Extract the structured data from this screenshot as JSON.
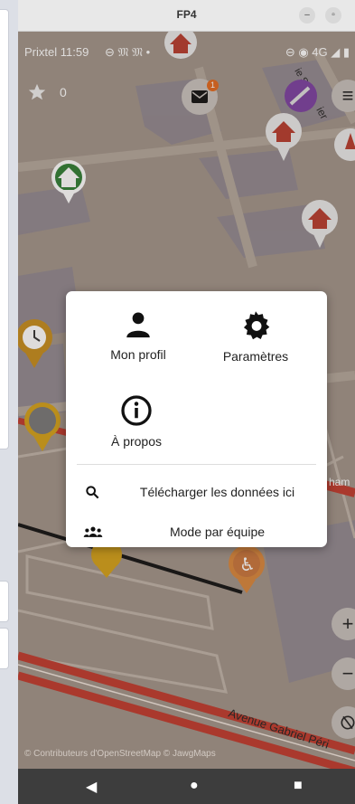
{
  "window": {
    "title": "FP4",
    "minimize": "–",
    "maximize": "▫"
  },
  "status": {
    "carrier_time": "Prixtel 11:59",
    "icons_left": "⊖ 𝔐 𝔐 •",
    "network": "⊖ ◉ 4G ◢ ▮"
  },
  "hud": {
    "star_count": "0",
    "mail_badge": "1"
  },
  "map": {
    "street_labels": [
      "Avenue Gabriel Péri",
      "ham",
      "ie",
      "Sep",
      "ier",
      "re"
    ],
    "attribution": "© Contributeurs d'OpenStreetMap  © JawgMaps"
  },
  "menu": {
    "profile": "Mon profil",
    "settings": "Paramètres",
    "about": "À propos",
    "download": "Télécharger les données ici",
    "team_mode": "Mode par équipe"
  },
  "controls": {
    "zoom_in": "+",
    "zoom_out": "−"
  },
  "nav": {
    "back": "◀",
    "home": "●",
    "recents": "■"
  },
  "colors": {
    "dialog_bg": "#ffffff",
    "road_red": "#c0392b",
    "marker_red": "#b63a2b",
    "badge_orange": "#e2671c"
  }
}
